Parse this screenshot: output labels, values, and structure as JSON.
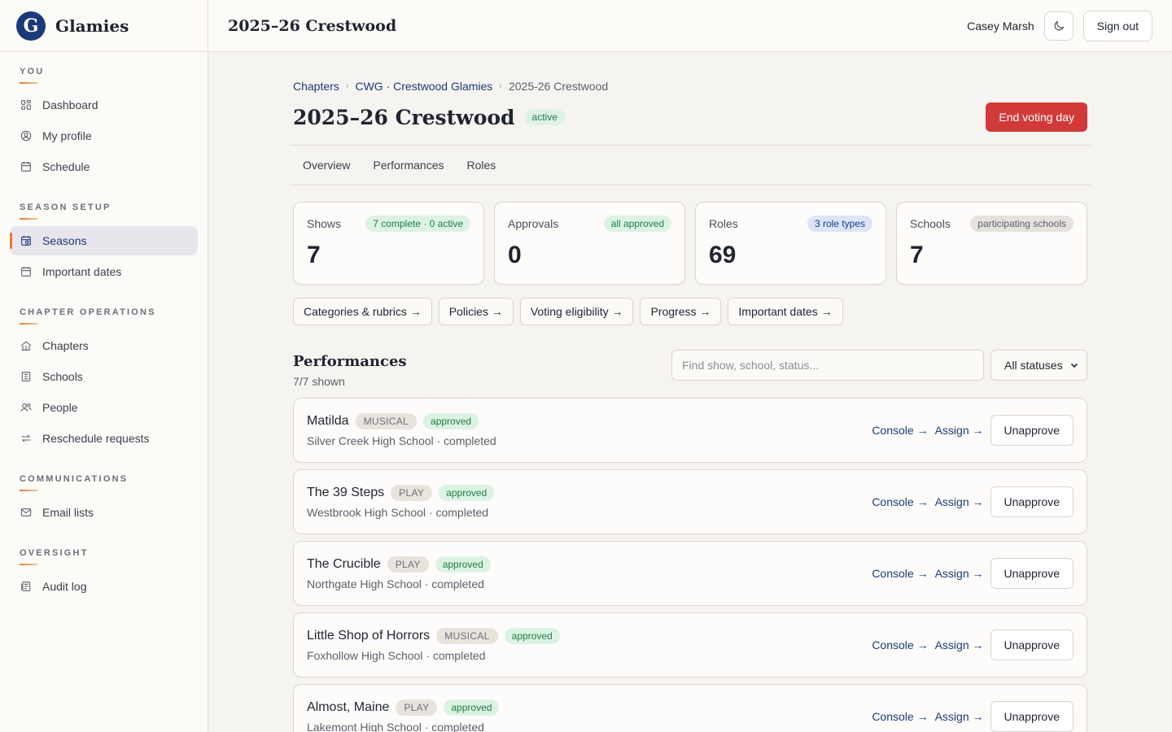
{
  "brand": {
    "name": "Glamies"
  },
  "sidebar": {
    "sections": [
      {
        "heading": "You",
        "items": [
          {
            "label": "Dashboard",
            "icon": "dashboard-icon"
          },
          {
            "label": "My profile",
            "icon": "profile-icon"
          },
          {
            "label": "Schedule",
            "icon": "calendar-icon"
          }
        ]
      },
      {
        "heading": "Season setup",
        "items": [
          {
            "label": "Seasons",
            "icon": "calendar-clock-icon",
            "active": true
          },
          {
            "label": "Important dates",
            "icon": "calendar-icon"
          }
        ]
      },
      {
        "heading": "Chapter operations",
        "items": [
          {
            "label": "Chapters",
            "icon": "chapters-icon"
          },
          {
            "label": "Schools",
            "icon": "school-icon"
          },
          {
            "label": "People",
            "icon": "people-icon"
          },
          {
            "label": "Reschedule requests",
            "icon": "reschedule-icon"
          }
        ]
      },
      {
        "heading": "Communications",
        "items": [
          {
            "label": "Email lists",
            "icon": "mail-icon"
          }
        ]
      },
      {
        "heading": "Oversight",
        "items": [
          {
            "label": "Audit log",
            "icon": "audit-icon"
          }
        ]
      }
    ]
  },
  "topbar": {
    "title": "2025–26 Crestwood",
    "user_name": "Casey Marsh",
    "theme_icon": "moon-icon",
    "sign_out": "Sign out"
  },
  "breadcrumb": {
    "items": [
      "Chapters",
      "CWG · Crestwood Glamies"
    ],
    "current": "2025-26 Crestwood"
  },
  "page": {
    "title": "2025–26 Crestwood",
    "status": "active",
    "end_voting": "End voting day"
  },
  "tabs": [
    "Overview",
    "Performances",
    "Roles"
  ],
  "stats": [
    {
      "label": "Shows",
      "badge": "7 complete · 0 active",
      "badge_style": "green",
      "value": "7"
    },
    {
      "label": "Approvals",
      "badge": "all approved",
      "badge_style": "green",
      "value": "0"
    },
    {
      "label": "Roles",
      "badge": "3 role types",
      "badge_style": "blue",
      "value": "69"
    },
    {
      "label": "Schools",
      "badge": "participating schools",
      "badge_style": "gray",
      "value": "7"
    }
  ],
  "quicklinks": [
    "Categories & rubrics →",
    "Policies →",
    "Voting eligibility →",
    "Progress →",
    "Important dates →"
  ],
  "performances": {
    "title": "Performances",
    "count": "7/7 shown",
    "search_placeholder": "Find show, school, status...",
    "status_filter": "All statuses",
    "console_label": "Console →",
    "assign_label": "Assign →",
    "unapprove_label": "Unapprove",
    "items": [
      {
        "name": "Matilda",
        "type": "MUSICAL",
        "status": "approved",
        "school": "Silver Creek High School · completed"
      },
      {
        "name": "The 39 Steps",
        "type": "PLAY",
        "status": "approved",
        "school": "Westbrook High School · completed"
      },
      {
        "name": "The Crucible",
        "type": "PLAY",
        "status": "approved",
        "school": "Northgate High School · completed"
      },
      {
        "name": "Little Shop of Horrors",
        "type": "MUSICAL",
        "status": "approved",
        "school": "Foxhollow High School · completed"
      },
      {
        "name": "Almost, Maine",
        "type": "PLAY",
        "status": "approved",
        "school": "Lakemont High School · completed"
      }
    ]
  },
  "colors": {
    "brand": "#1b3a7a",
    "accent": "#e8792f",
    "danger": "#d23a3a",
    "success_bg": "#dcf3e3"
  }
}
